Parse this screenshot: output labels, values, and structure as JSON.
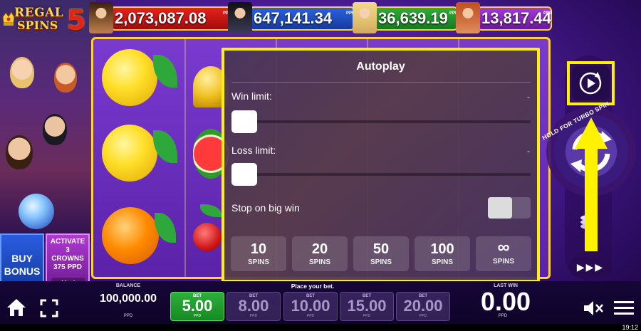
{
  "game": {
    "logo_line1": "REGAL",
    "logo_line2": "SPINS",
    "logo_number": "5"
  },
  "jackpots": [
    {
      "value": "2,073,087.08",
      "unit": "PPD",
      "color": "#e8201a"
    },
    {
      "value": "647,141.34",
      "unit": "PPD",
      "color": "#2a62e0"
    },
    {
      "value": "36,639.19",
      "unit": "PPD",
      "color": "#2eae3a"
    },
    {
      "value": "13,817.44",
      "unit": "PPD",
      "color": "#a43ad8"
    }
  ],
  "autoplay": {
    "title": "Autoplay",
    "win_limit_label": "Win limit:",
    "win_limit_value": "-",
    "loss_limit_label": "Loss limit:",
    "loss_limit_value": "-",
    "stop_big_win_label": "Stop on big win",
    "stop_big_win_enabled": false,
    "spin_options": [
      {
        "count": "10",
        "label": "SPINS"
      },
      {
        "count": "20",
        "label": "SPINS"
      },
      {
        "count": "50",
        "label": "SPINS"
      },
      {
        "count": "100",
        "label": "SPINS"
      },
      {
        "count": "∞",
        "label": "SPINS"
      }
    ]
  },
  "controls": {
    "hold_text": "HOLD FOR TURBO SPIN",
    "play3": "▶▶▶"
  },
  "bonus": {
    "buy_line1": "BUY",
    "buy_line2": "BONUS",
    "activate_line1": "ACTIVATE",
    "activate_line2": "3",
    "activate_line3": "CROWNS",
    "activate_line4": "375 PPD",
    "activate_actions": "✕ ✓"
  },
  "bottom": {
    "balance_label": "BALANCE",
    "balance_value": "100,000.00",
    "balance_unit": "PPD",
    "place_bet": "Place your bet.",
    "bets": [
      {
        "label": "BET",
        "value": "5.00",
        "unit": "PPD",
        "selected": true
      },
      {
        "label": "BET",
        "value": "8.00",
        "unit": "PPD",
        "selected": false
      },
      {
        "label": "BET",
        "value": "10.00",
        "unit": "PPD",
        "selected": false
      },
      {
        "label": "BET",
        "value": "15.00",
        "unit": "PPD",
        "selected": false
      },
      {
        "label": "BET",
        "value": "20.00",
        "unit": "PPD",
        "selected": false
      }
    ],
    "last_win_label": "LAST WIN",
    "last_win_value": "0.00",
    "last_win_unit": "PPD"
  },
  "status_bar": {
    "time": "19:12"
  }
}
